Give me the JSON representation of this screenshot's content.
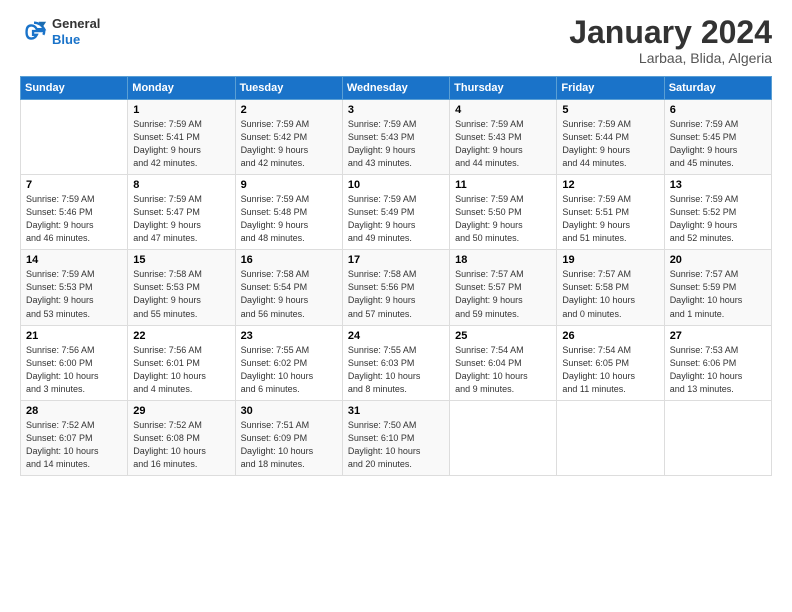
{
  "logo": {
    "general": "General",
    "blue": "Blue"
  },
  "header": {
    "month": "January 2024",
    "location": "Larbaa, Blida, Algeria"
  },
  "weekdays": [
    "Sunday",
    "Monday",
    "Tuesday",
    "Wednesday",
    "Thursday",
    "Friday",
    "Saturday"
  ],
  "weeks": [
    [
      {
        "day": "",
        "info": ""
      },
      {
        "day": "1",
        "info": "Sunrise: 7:59 AM\nSunset: 5:41 PM\nDaylight: 9 hours\nand 42 minutes."
      },
      {
        "day": "2",
        "info": "Sunrise: 7:59 AM\nSunset: 5:42 PM\nDaylight: 9 hours\nand 42 minutes."
      },
      {
        "day": "3",
        "info": "Sunrise: 7:59 AM\nSunset: 5:43 PM\nDaylight: 9 hours\nand 43 minutes."
      },
      {
        "day": "4",
        "info": "Sunrise: 7:59 AM\nSunset: 5:43 PM\nDaylight: 9 hours\nand 44 minutes."
      },
      {
        "day": "5",
        "info": "Sunrise: 7:59 AM\nSunset: 5:44 PM\nDaylight: 9 hours\nand 44 minutes."
      },
      {
        "day": "6",
        "info": "Sunrise: 7:59 AM\nSunset: 5:45 PM\nDaylight: 9 hours\nand 45 minutes."
      }
    ],
    [
      {
        "day": "7",
        "info": "Sunrise: 7:59 AM\nSunset: 5:46 PM\nDaylight: 9 hours\nand 46 minutes."
      },
      {
        "day": "8",
        "info": "Sunrise: 7:59 AM\nSunset: 5:47 PM\nDaylight: 9 hours\nand 47 minutes."
      },
      {
        "day": "9",
        "info": "Sunrise: 7:59 AM\nSunset: 5:48 PM\nDaylight: 9 hours\nand 48 minutes."
      },
      {
        "day": "10",
        "info": "Sunrise: 7:59 AM\nSunset: 5:49 PM\nDaylight: 9 hours\nand 49 minutes."
      },
      {
        "day": "11",
        "info": "Sunrise: 7:59 AM\nSunset: 5:50 PM\nDaylight: 9 hours\nand 50 minutes."
      },
      {
        "day": "12",
        "info": "Sunrise: 7:59 AM\nSunset: 5:51 PM\nDaylight: 9 hours\nand 51 minutes."
      },
      {
        "day": "13",
        "info": "Sunrise: 7:59 AM\nSunset: 5:52 PM\nDaylight: 9 hours\nand 52 minutes."
      }
    ],
    [
      {
        "day": "14",
        "info": "Sunrise: 7:59 AM\nSunset: 5:53 PM\nDaylight: 9 hours\nand 53 minutes."
      },
      {
        "day": "15",
        "info": "Sunrise: 7:58 AM\nSunset: 5:53 PM\nDaylight: 9 hours\nand 55 minutes."
      },
      {
        "day": "16",
        "info": "Sunrise: 7:58 AM\nSunset: 5:54 PM\nDaylight: 9 hours\nand 56 minutes."
      },
      {
        "day": "17",
        "info": "Sunrise: 7:58 AM\nSunset: 5:56 PM\nDaylight: 9 hours\nand 57 minutes."
      },
      {
        "day": "18",
        "info": "Sunrise: 7:57 AM\nSunset: 5:57 PM\nDaylight: 9 hours\nand 59 minutes."
      },
      {
        "day": "19",
        "info": "Sunrise: 7:57 AM\nSunset: 5:58 PM\nDaylight: 10 hours\nand 0 minutes."
      },
      {
        "day": "20",
        "info": "Sunrise: 7:57 AM\nSunset: 5:59 PM\nDaylight: 10 hours\nand 1 minute."
      }
    ],
    [
      {
        "day": "21",
        "info": "Sunrise: 7:56 AM\nSunset: 6:00 PM\nDaylight: 10 hours\nand 3 minutes."
      },
      {
        "day": "22",
        "info": "Sunrise: 7:56 AM\nSunset: 6:01 PM\nDaylight: 10 hours\nand 4 minutes."
      },
      {
        "day": "23",
        "info": "Sunrise: 7:55 AM\nSunset: 6:02 PM\nDaylight: 10 hours\nand 6 minutes."
      },
      {
        "day": "24",
        "info": "Sunrise: 7:55 AM\nSunset: 6:03 PM\nDaylight: 10 hours\nand 8 minutes."
      },
      {
        "day": "25",
        "info": "Sunrise: 7:54 AM\nSunset: 6:04 PM\nDaylight: 10 hours\nand 9 minutes."
      },
      {
        "day": "26",
        "info": "Sunrise: 7:54 AM\nSunset: 6:05 PM\nDaylight: 10 hours\nand 11 minutes."
      },
      {
        "day": "27",
        "info": "Sunrise: 7:53 AM\nSunset: 6:06 PM\nDaylight: 10 hours\nand 13 minutes."
      }
    ],
    [
      {
        "day": "28",
        "info": "Sunrise: 7:52 AM\nSunset: 6:07 PM\nDaylight: 10 hours\nand 14 minutes."
      },
      {
        "day": "29",
        "info": "Sunrise: 7:52 AM\nSunset: 6:08 PM\nDaylight: 10 hours\nand 16 minutes."
      },
      {
        "day": "30",
        "info": "Sunrise: 7:51 AM\nSunset: 6:09 PM\nDaylight: 10 hours\nand 18 minutes."
      },
      {
        "day": "31",
        "info": "Sunrise: 7:50 AM\nSunset: 6:10 PM\nDaylight: 10 hours\nand 20 minutes."
      },
      {
        "day": "",
        "info": ""
      },
      {
        "day": "",
        "info": ""
      },
      {
        "day": "",
        "info": ""
      }
    ]
  ]
}
